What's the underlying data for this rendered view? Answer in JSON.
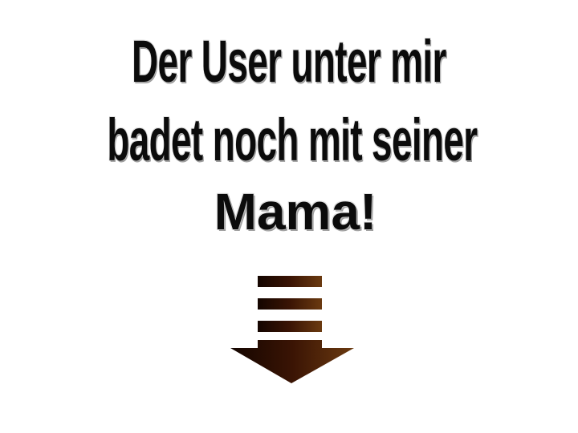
{
  "text": {
    "line1": "Der User unter mir",
    "line2": "badet noch mit seiner",
    "line3": "Mama!"
  },
  "arrow": {
    "icon": "down-arrow-icon",
    "color_dark": "#140500",
    "color_mid": "#4a1a05",
    "color_light": "#6b3a10"
  }
}
